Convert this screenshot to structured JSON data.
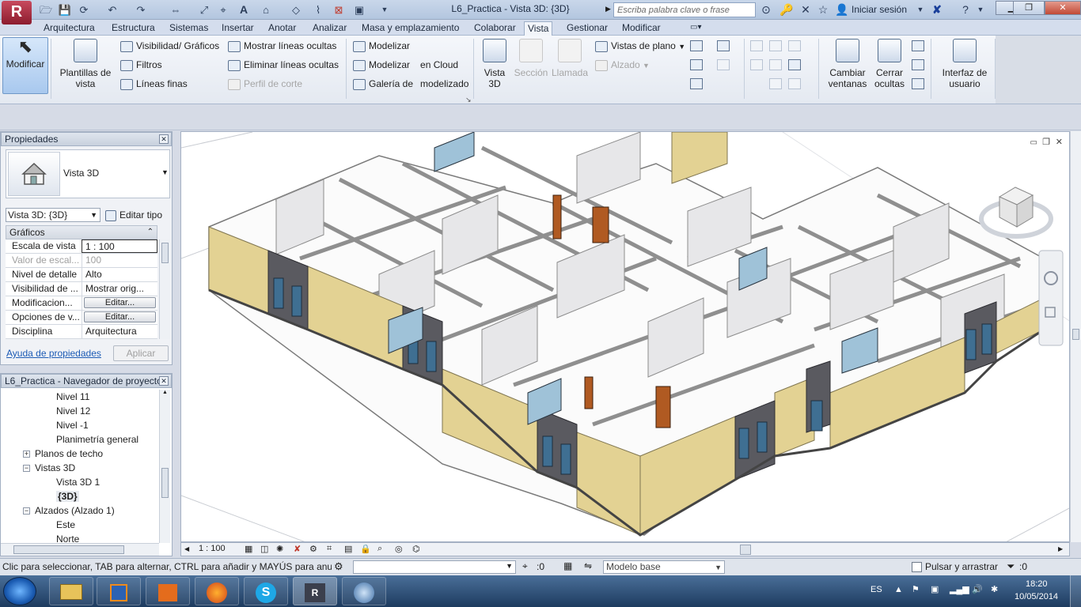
{
  "titlebar": {
    "logo": "R",
    "document_title": "L6_Practica - Vista 3D: {3D}",
    "search_placeholder": "Escriba palabra clave o frase",
    "sign_in": "Iniciar sesión"
  },
  "menu_tabs": [
    "Arquitectura",
    "Estructura",
    "Sistemas",
    "Insertar",
    "Anotar",
    "Analizar",
    "Masa y emplazamiento",
    "Colaborar",
    "Vista",
    "Gestionar",
    "Modificar"
  ],
  "active_tab": "Vista",
  "ribbon": {
    "modify": "Modificar",
    "templates": [
      "Plantillas de",
      "vista"
    ],
    "graphics_items": [
      "Visibilidad/ Gráficos",
      "Filtros",
      "Líneas finas"
    ],
    "lines_items": [
      "Mostrar líneas ocultas",
      "Eliminar líneas ocultas",
      "Perfil de corte"
    ],
    "render_items": [
      "Modelizar",
      "Modelizar",
      "en Cloud",
      "Galería de",
      "modelizado"
    ],
    "create": {
      "vista_3d": [
        "Vista",
        "3D"
      ],
      "seccion": "Sección",
      "llamada": "Llamada",
      "vistas_plano": "Vistas de plano",
      "alzado": "Alzado"
    },
    "windows": {
      "cambiar": [
        "Cambiar",
        "ventanas"
      ],
      "cerrar": [
        "Cerrar",
        "ocultas"
      ],
      "interfaz": [
        "Interfaz de",
        "usuario"
      ]
    }
  },
  "properties": {
    "header": "Propiedades",
    "type_name": "Vista 3D",
    "view_selector": "Vista 3D: {3D}",
    "edit_type": "Editar tipo",
    "section": "Gráficos",
    "rows": [
      {
        "k": "Escala de vista",
        "v": "1 : 100",
        "dis": false
      },
      {
        "k": "Valor de escal...",
        "v": "100",
        "dis": true
      },
      {
        "k": "Nivel de detalle",
        "v": "Alto",
        "dis": false
      },
      {
        "k": "Visibilidad de ...",
        "v": "Mostrar orig...",
        "dis": false
      },
      {
        "k": "Modificacion...",
        "v": "Editar...",
        "dis": false
      },
      {
        "k": "Opciones de v...",
        "v": "Editar...",
        "dis": false
      },
      {
        "k": "Disciplina",
        "v": "Arquitectura",
        "dis": false
      }
    ],
    "help_link": "Ayuda de propiedades",
    "apply": "Aplicar"
  },
  "browser": {
    "header": "L6_Practica - Navegador de proyectos",
    "items": [
      {
        "label": "Nivel 11",
        "indent": 3,
        "exp": ""
      },
      {
        "label": "Nivel 12",
        "indent": 3,
        "exp": ""
      },
      {
        "label": "Nivel -1",
        "indent": 3,
        "exp": ""
      },
      {
        "label": "Planimetría general",
        "indent": 3,
        "exp": ""
      },
      {
        "label": "Planos de techo",
        "indent": 2,
        "exp": "+"
      },
      {
        "label": "Vistas 3D",
        "indent": 2,
        "exp": "-"
      },
      {
        "label": "Vista 3D 1",
        "indent": 3,
        "exp": ""
      },
      {
        "label": "{3D}",
        "indent": 3,
        "exp": "",
        "bold": true
      },
      {
        "label": "Alzados (Alzado 1)",
        "indent": 2,
        "exp": "-"
      },
      {
        "label": "Este",
        "indent": 3,
        "exp": ""
      },
      {
        "label": "Norte",
        "indent": 3,
        "exp": ""
      }
    ]
  },
  "view_controls": {
    "scale": "1 : 100"
  },
  "status": {
    "message": "Clic para seleccionar, TAB para alternar, CTRL para añadir y MAYÚS para anular",
    "count_a": ":0",
    "model": "Modelo base",
    "drag_label": "Pulsar y arrastrar",
    "count_b": ":0"
  },
  "taskbar": {
    "lang": "ES",
    "time": "18:20",
    "date": "10/05/2014"
  },
  "colors": {
    "wall_exterior": "#e3d293",
    "floor": "#ffffff",
    "accent": "#3d6fb0"
  }
}
